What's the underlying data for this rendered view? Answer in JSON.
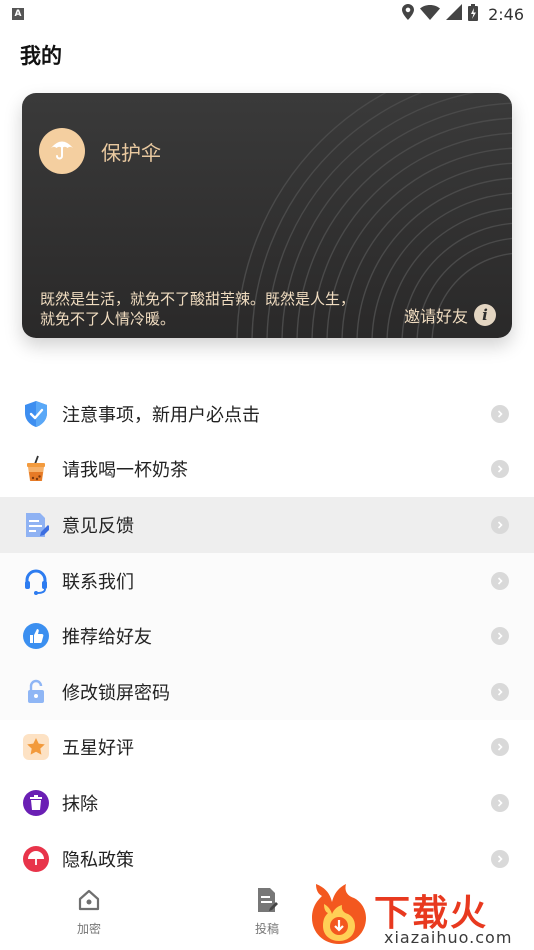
{
  "status_bar": {
    "notification_letter": "A",
    "time": "2:46"
  },
  "page": {
    "title": "我的"
  },
  "card": {
    "title": "保护伞",
    "quote": "既然是生活，就免不了酸甜苦辣。既然是人生，\n就免不了人情冷暖。",
    "invite_label": "邀请好友",
    "info_icon_glyph": "i",
    "colors": {
      "background": "#2f2e2e",
      "text": "#f0dcc0",
      "avatar": "#f4cfa0"
    }
  },
  "menu": {
    "items": [
      {
        "label": "注意事项，新用户必点击",
        "icon": "shield-check-icon"
      },
      {
        "label": "请我喝一杯奶茶",
        "icon": "milk-tea-icon"
      },
      {
        "label": "意见反馈",
        "icon": "feedback-document-icon"
      },
      {
        "label": "联系我们",
        "icon": "headset-icon"
      },
      {
        "label": "推荐给好友",
        "icon": "thumbs-up-icon"
      },
      {
        "label": "修改锁屏密码",
        "icon": "unlock-icon"
      },
      {
        "label": "五星好评",
        "icon": "star-icon"
      },
      {
        "label": "抹除",
        "icon": "trash-icon"
      },
      {
        "label": "隐私政策",
        "icon": "privacy-umbrella-icon"
      }
    ]
  },
  "bottom_nav": {
    "tabs": [
      {
        "label": "加密",
        "icon": "home-lock-icon"
      },
      {
        "label": "投稿",
        "icon": "document-edit-icon"
      }
    ]
  },
  "watermark": {
    "brand": "下载火",
    "url": "xiazaihuo.com"
  }
}
